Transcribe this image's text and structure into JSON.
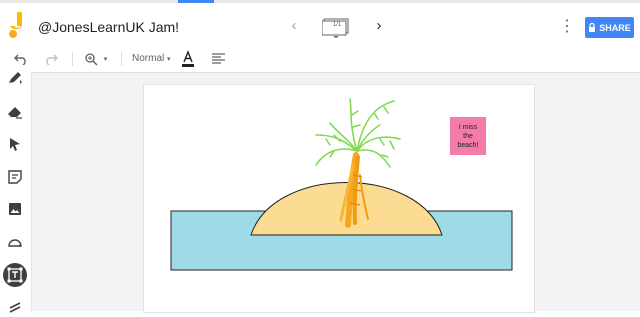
{
  "app": {
    "title": "@JonesLearnUK Jam!",
    "frame_indicator": "1/1",
    "share_label": "SHARE",
    "accent_color": "#4285f4",
    "logo_color": "#fbbc04"
  },
  "toolbar": {
    "icons": [
      "undo-icon",
      "redo-icon",
      "zoom-icon",
      "text-color-icon",
      "align-icon"
    ],
    "font_style": "Normal"
  },
  "tools": [
    "pen-icon",
    "eraser-icon",
    "select-icon",
    "sticky-note-icon",
    "image-icon",
    "circle-icon",
    "text-box-icon",
    "laser-icon"
  ],
  "canvas": {
    "sticky_note": {
      "text": "I miss\nthe\nbeach!",
      "color": "#f47cab"
    },
    "colors": {
      "sea": "#9edbe6",
      "sand": "#fcdc93",
      "trunk": "#f6a623",
      "leaves": "#7dd94a"
    }
  }
}
